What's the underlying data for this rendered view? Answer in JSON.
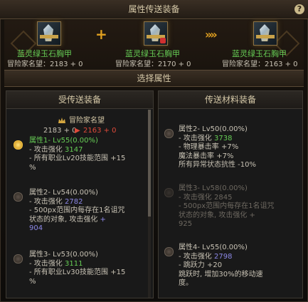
{
  "window": {
    "title": "属性传送装备",
    "help_glyph": "?"
  },
  "top": {
    "items": [
      {
        "name": "蓝灵绿玉石胸甲",
        "fame": "冒险家名望：2183 + 0"
      },
      {
        "name": "蓝灵绿玉石胸甲",
        "fame": "冒险家名望：2170 + 0"
      },
      {
        "name": "蓝灵绿玉石胸甲",
        "fame": "冒险家名望：2163 + 0"
      }
    ],
    "plus_glyph": "+",
    "arrow_glyph": "»»"
  },
  "section_title": "选择属性",
  "left": {
    "header": "受传送装备",
    "fame_label": "冒险家名望",
    "fame_from": "2183 + 0",
    "fame_arrow": "▶",
    "fame_to": "2163 + 0",
    "options": [
      {
        "title": "属性1-  Lv55(0.00%)",
        "lines": [
          {
            "label": "- 攻击强化",
            "value": "3147"
          },
          {
            "label": "- 所有职业Lv20技能范围",
            "value": "+15"
          },
          {
            "label": "%",
            "value": ""
          }
        ]
      },
      {
        "title": "属性2-  Lv54(0.00%)",
        "lines": [
          {
            "label": "- 攻击强化",
            "value": "2782"
          },
          {
            "label": "- 500px范围内每存在1名诅咒",
            "value": ""
          },
          {
            "label": "  状态的对象, 攻击强化",
            "value": "+"
          },
          {
            "label": "",
            "value": "904"
          }
        ]
      },
      {
        "title": "属性3-  Lv53(0.00%)",
        "lines": [
          {
            "label": "- 攻击强化",
            "value": "3111"
          },
          {
            "label": "- 所有职业Lv30技能范围",
            "value": "+15"
          },
          {
            "label": "%",
            "value": ""
          }
        ]
      }
    ]
  },
  "right": {
    "header": "传送材料装备",
    "options": [
      {
        "title": "属性2-  Lv50(0.00%)",
        "lines": [
          {
            "label": "- 攻击强化",
            "value": "3738"
          },
          {
            "label": "- 物理暴击率",
            "value": "+7%"
          },
          {
            "label": "  魔法暴击率",
            "value": "+7%"
          },
          {
            "label": "  所有异常状态抗性 -10%",
            "value": ""
          }
        ]
      },
      {
        "title": "属性3-  Lv58(0.00%)",
        "lines": [
          {
            "label": "- 攻击强化",
            "value": "2845"
          },
          {
            "label": "- 500px范围内每存在1名诅咒",
            "value": ""
          },
          {
            "label": "  状态的对象, 攻击强化",
            "value": "+"
          },
          {
            "label": "  925",
            "value": ""
          }
        ]
      },
      {
        "title": "属性4-  Lv55(0.00%)",
        "lines": [
          {
            "label": "- 攻击强化",
            "value": "2798"
          },
          {
            "label": "- 跳跃力 +20",
            "value": ""
          },
          {
            "label": "  跳跃时, 增加30%的移动速",
            "value": ""
          },
          {
            "label": "  度。",
            "value": ""
          }
        ]
      }
    ]
  },
  "colors": {
    "item_name": "#66cc55",
    "accent": "#e0a020",
    "value_purple": "#8c88e6",
    "fame_new": "#e04a3a"
  },
  "icons": [
    "chest-armor-icon",
    "crown-emblem-icon",
    "help-icon"
  ]
}
